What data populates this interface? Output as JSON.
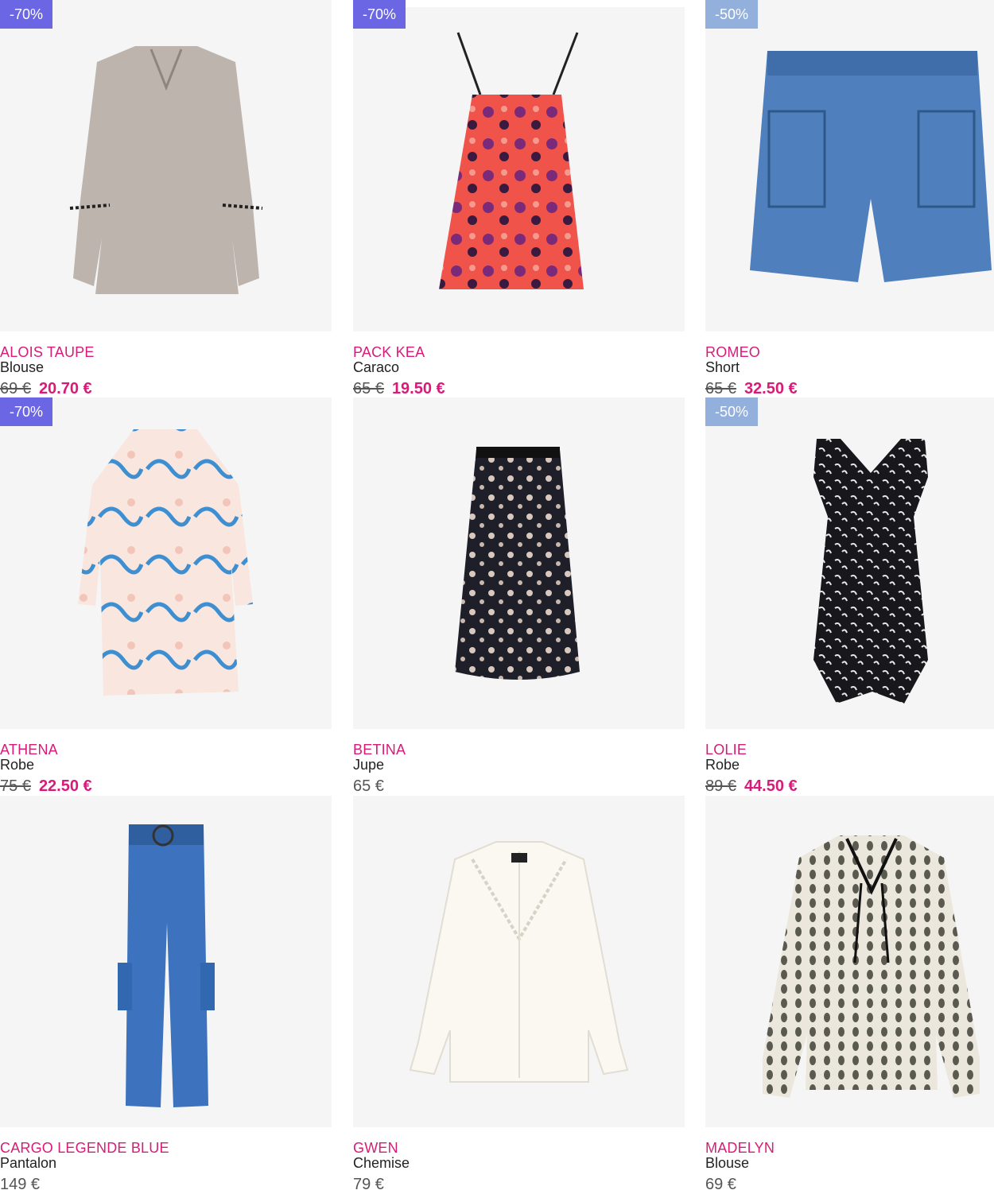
{
  "products": [
    {
      "badge": "-70%",
      "name": "ALOIS TAUPE",
      "type": "Blouse",
      "old_price": "69 €",
      "price": "20.70 €",
      "icon": "taupe-blouse-icon"
    },
    {
      "badge": "-70%",
      "name": "PACK KEA",
      "type": "Caraco",
      "old_price": "65 €",
      "price": "19.50 €",
      "icon": "floral-camisole-icon"
    },
    {
      "badge": "-50%",
      "name": "ROMEO",
      "type": "Short",
      "old_price": "65 €",
      "price": "32.50 €",
      "icon": "denim-shorts-icon"
    },
    {
      "badge": "-70%",
      "name": "ATHENA",
      "type": "Robe",
      "old_price": "75 €",
      "price": "22.50 €",
      "icon": "printed-dress-icon"
    },
    {
      "badge": "",
      "name": "BETINA",
      "type": "Jupe",
      "old_price": "",
      "price": "65 €",
      "icon": "lace-skirt-icon"
    },
    {
      "badge": "-50%",
      "name": "LOLIE",
      "type": "Robe",
      "old_price": "89 €",
      "price": "44.50 €",
      "icon": "black-dress-icon"
    },
    {
      "badge": "",
      "name": "CARGO LEGENDE BLUE",
      "type": "Pantalon",
      "old_price": "",
      "price": "149 €",
      "icon": "cargo-pants-icon"
    },
    {
      "badge": "",
      "name": "GWEN",
      "type": "Chemise",
      "old_price": "",
      "price": "79 €",
      "icon": "white-shirt-icon"
    },
    {
      "badge": "",
      "name": "MADELYN",
      "type": "Blouse",
      "old_price": "",
      "price": "69 €",
      "icon": "patterned-blouse-icon"
    }
  ],
  "colors": {
    "accent": "#d81b79",
    "badge_70": "#6b66e3",
    "badge_50": "#93b0dc",
    "image_bg": "#f5f5f5"
  }
}
